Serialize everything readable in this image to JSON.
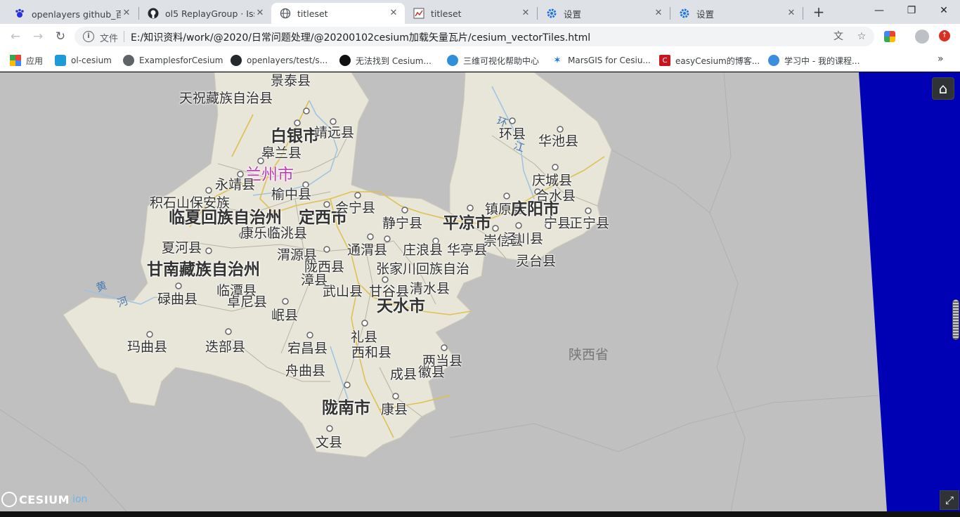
{
  "tabs": [
    {
      "title": "openlayers github_百度",
      "favicon": "baidu-paw-icon",
      "active": false
    },
    {
      "title": "ol5 ReplayGroup · Issu",
      "favicon": "github-icon",
      "active": false
    },
    {
      "title": "titleset",
      "favicon": "globe-icon",
      "active": true
    },
    {
      "title": "titleset",
      "favicon": "chart-icon",
      "active": false
    },
    {
      "title": "设置",
      "favicon": "gear-icon",
      "active": false
    },
    {
      "title": "设置",
      "favicon": "gear-icon",
      "active": false
    }
  ],
  "address": {
    "scheme_label": "文件",
    "url": "E:/知识资料/work/@2020/日常问题处理/@20200102cesium加载矢量瓦片/cesium_vectorTiles.html"
  },
  "bookmarks": [
    {
      "label": "应用",
      "icon": "apps-grid-icon"
    },
    {
      "label": "ol-cesium",
      "icon": "layers-icon"
    },
    {
      "label": "ExamplesforCesium",
      "icon": "globe-icon"
    },
    {
      "label": "openlayers/test/s...",
      "icon": "github-icon"
    },
    {
      "label": "无法找到 Cesium...",
      "icon": "cesium-dark-icon"
    },
    {
      "label": "三维可视化帮助中心",
      "icon": "swirl-icon"
    },
    {
      "label": "MarsGIS for Cesiu...",
      "icon": "mars-star-icon"
    },
    {
      "label": "easyCesium的博客...",
      "icon": "csdn-icon"
    },
    {
      "label": "学习中 - 我的课程...",
      "icon": "cloud-icon"
    }
  ],
  "map": {
    "colors": {
      "land": "#e8e6d9",
      "background": "#c0c0c0",
      "ocean": "#0000b4",
      "road": "#e0c050",
      "capital": "#c23cb4"
    },
    "labels": [
      {
        "text": "景泰县",
        "kind": "county"
      },
      {
        "text": "天祝藏族自治县",
        "kind": "county"
      },
      {
        "text": "白银市",
        "kind": "city"
      },
      {
        "text": "靖远县",
        "kind": "county"
      },
      {
        "text": "皋兰县",
        "kind": "county"
      },
      {
        "text": "兰州市",
        "kind": "capital"
      },
      {
        "text": "永靖县",
        "kind": "county"
      },
      {
        "text": "榆中县",
        "kind": "county"
      },
      {
        "text": "积石山保安族",
        "kind": "county"
      },
      {
        "text": "临夏回族自治州",
        "kind": "city"
      },
      {
        "text": "定西市",
        "kind": "city"
      },
      {
        "text": "会宁县",
        "kind": "county"
      },
      {
        "text": "康乐县",
        "kind": "county"
      },
      {
        "text": "临洮县",
        "kind": "county"
      },
      {
        "text": "静宁县",
        "kind": "county"
      },
      {
        "text": "平凉市",
        "kind": "city"
      },
      {
        "text": "夏河县",
        "kind": "county"
      },
      {
        "text": "渭源县",
        "kind": "county"
      },
      {
        "text": "通渭县",
        "kind": "county"
      },
      {
        "text": "庄浪县",
        "kind": "county"
      },
      {
        "text": "华亭县",
        "kind": "county"
      },
      {
        "text": "甘南藏族自治州",
        "kind": "city"
      },
      {
        "text": "陇西县",
        "kind": "county"
      },
      {
        "text": "张家川回族自治",
        "kind": "county"
      },
      {
        "text": "漳县",
        "kind": "county"
      },
      {
        "text": "武山县",
        "kind": "county"
      },
      {
        "text": "甘谷县",
        "kind": "county"
      },
      {
        "text": "清水县",
        "kind": "county"
      },
      {
        "text": "临潭县",
        "kind": "county"
      },
      {
        "text": "卓尼县",
        "kind": "county"
      },
      {
        "text": "碌曲县",
        "kind": "county"
      },
      {
        "text": "天水市",
        "kind": "city"
      },
      {
        "text": "岷县",
        "kind": "county"
      },
      {
        "text": "玛曲县",
        "kind": "county"
      },
      {
        "text": "迭部县",
        "kind": "county"
      },
      {
        "text": "宕昌县",
        "kind": "county"
      },
      {
        "text": "礼县",
        "kind": "county"
      },
      {
        "text": "西和县",
        "kind": "county"
      },
      {
        "text": "两当县",
        "kind": "county"
      },
      {
        "text": "成县",
        "kind": "county"
      },
      {
        "text": "徽县",
        "kind": "county"
      },
      {
        "text": "舟曲县",
        "kind": "county"
      },
      {
        "text": "陇南市",
        "kind": "city"
      },
      {
        "text": "康县",
        "kind": "county"
      },
      {
        "text": "文县",
        "kind": "county"
      },
      {
        "text": "环县",
        "kind": "county"
      },
      {
        "text": "华池县",
        "kind": "county"
      },
      {
        "text": "庆城县",
        "kind": "county"
      },
      {
        "text": "合水县",
        "kind": "county"
      },
      {
        "text": "镇原县",
        "kind": "county"
      },
      {
        "text": "庆阳市",
        "kind": "city"
      },
      {
        "text": "宁县",
        "kind": "county"
      },
      {
        "text": "正宁县",
        "kind": "county"
      },
      {
        "text": "崇信县",
        "kind": "county"
      },
      {
        "text": "泾川县",
        "kind": "county"
      },
      {
        "text": "灵台县",
        "kind": "county"
      },
      {
        "text": "陕西省",
        "kind": "province"
      },
      {
        "text": "黄",
        "kind": "river"
      },
      {
        "text": "河",
        "kind": "river"
      },
      {
        "text": "环",
        "kind": "river"
      },
      {
        "text": "江",
        "kind": "river"
      }
    ]
  },
  "viewer": {
    "home_icon": "home-icon",
    "fullscreen_icon": "fullscreen-icon",
    "logo_text": "CESIUM",
    "logo_suffix": "ion"
  }
}
